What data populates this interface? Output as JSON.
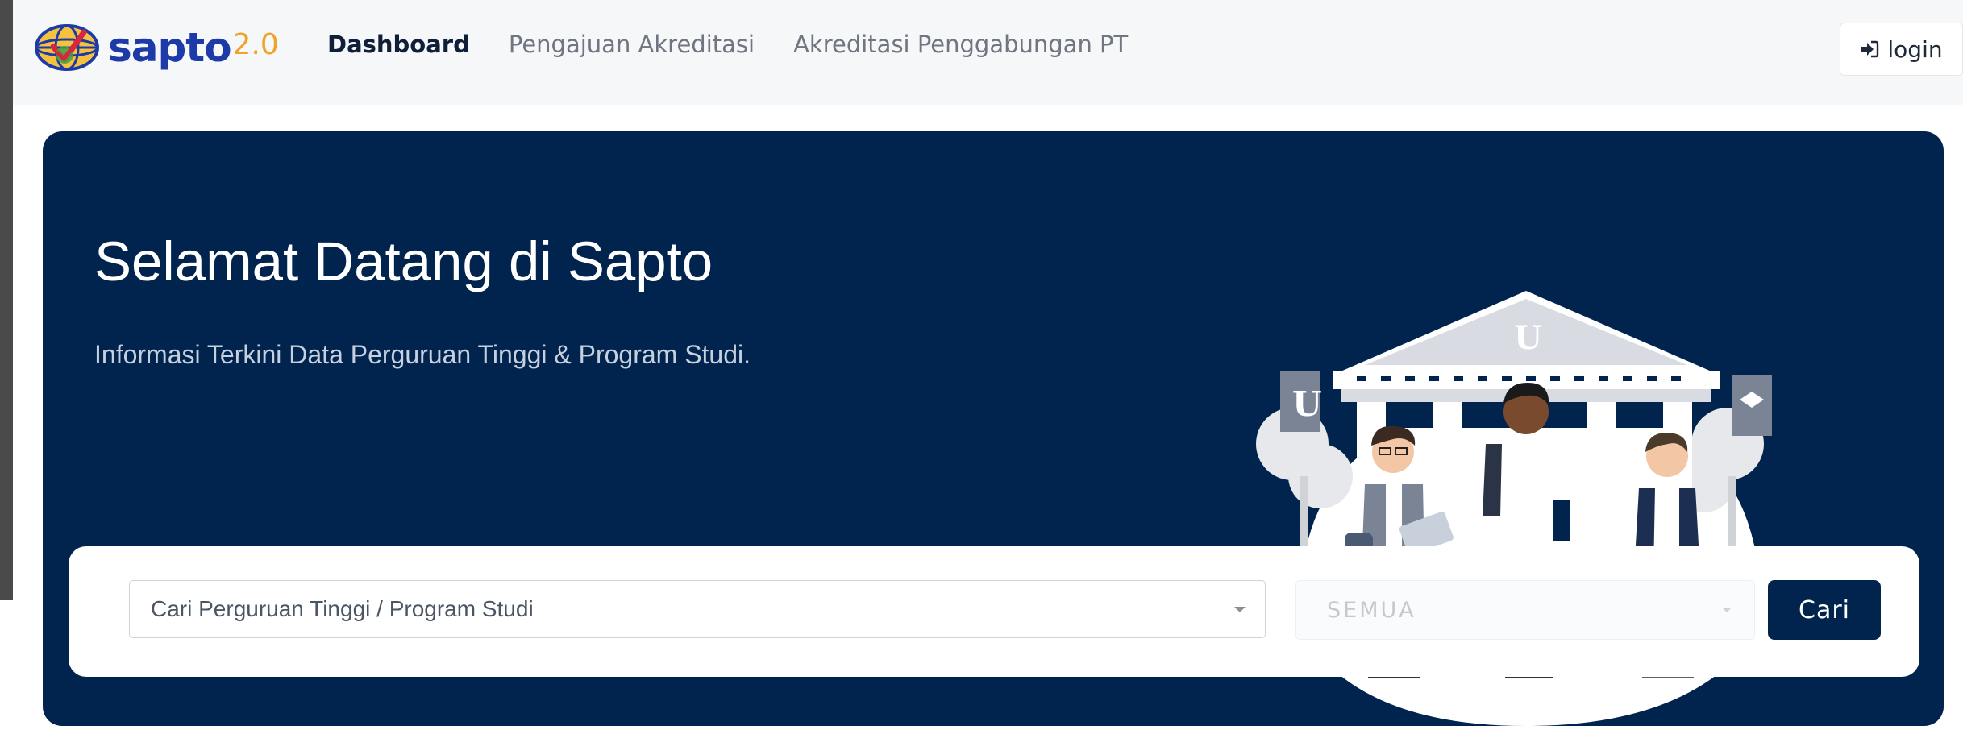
{
  "brand": {
    "name": "sapto",
    "version": "2.0"
  },
  "nav": {
    "items": [
      {
        "label": "Dashboard",
        "active": true
      },
      {
        "label": "Pengajuan Akreditasi",
        "active": false
      },
      {
        "label": "Akreditasi Penggabungan PT",
        "active": false
      }
    ],
    "login_label": "login",
    "login_icon": "sign-in-icon"
  },
  "hero": {
    "title": "Selamat Datang di Sapto",
    "subtitle": "Informasi Terkini Data Perguruan Tinggi & Program Studi."
  },
  "search": {
    "placeholder": "Cari Perguruan Tinggi / Program Studi",
    "filter_value": "SEMUA",
    "button_label": "Cari"
  },
  "colors": {
    "navy": "#01244f",
    "brand_blue": "#1c3ba8",
    "brand_orange": "#f0a32a",
    "navbar_bg": "#f6f7f8"
  }
}
